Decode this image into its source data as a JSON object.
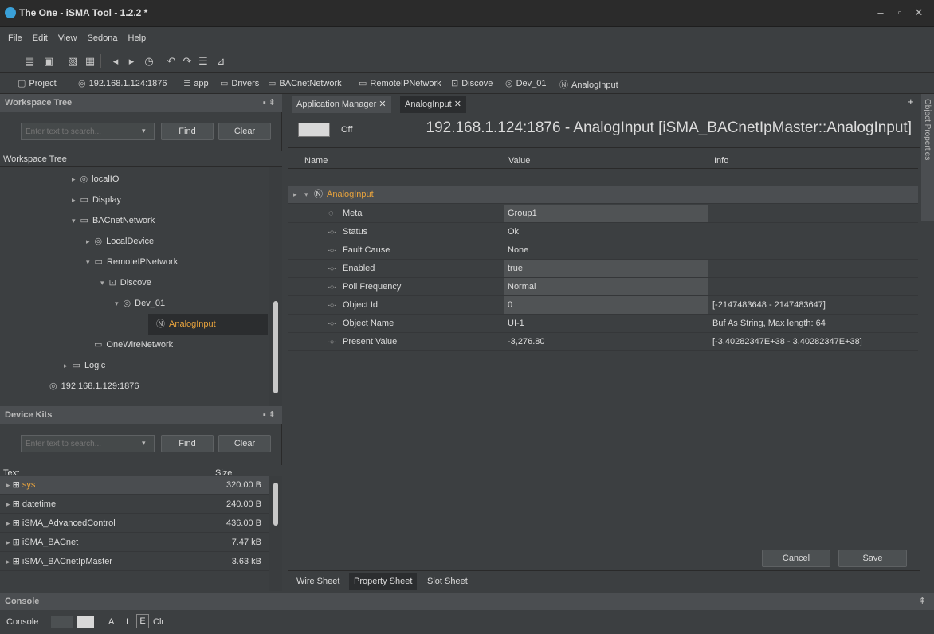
{
  "window": {
    "title": "The One - iSMA Tool - 1.2.2 *"
  },
  "menu": [
    "File",
    "Edit",
    "View",
    "Sedona",
    "Help"
  ],
  "breadcrumb": [
    {
      "icon": "document-icon",
      "label": "Project"
    },
    {
      "icon": "device-icon",
      "label": "192.168.1.124:1876"
    },
    {
      "icon": "database-icon",
      "label": "app"
    },
    {
      "icon": "folder-icon",
      "label": "Drivers"
    },
    {
      "icon": "folder-icon",
      "label": "BACnetNetwork"
    },
    {
      "icon": "folder-icon",
      "label": "RemoteIPNetwork"
    },
    {
      "icon": "discover-icon",
      "label": "Discove"
    },
    {
      "icon": "device-icon",
      "label": "Dev_01"
    },
    {
      "icon": "n-circle-icon",
      "label": "AnalogInput"
    }
  ],
  "workspace": {
    "header": "Workspace Tree",
    "search_placeholder": "Enter text to search...",
    "find": "Find",
    "clear": "Clear",
    "column": "Workspace Tree",
    "items": [
      {
        "label": "localIO",
        "icon": "device-icon",
        "arrow": "▸"
      },
      {
        "label": "Display",
        "icon": "display-icon",
        "arrow": "▸"
      },
      {
        "label": "BACnetNetwork",
        "icon": "folder-icon",
        "arrow": "▾"
      },
      {
        "label": "LocalDevice",
        "icon": "device-icon",
        "arrow": "▸"
      },
      {
        "label": "RemoteIPNetwork",
        "icon": "folder-icon",
        "arrow": "▾"
      },
      {
        "label": "Discove",
        "icon": "discover-icon",
        "arrow": "▾"
      },
      {
        "label": "Dev_01",
        "icon": "device-icon",
        "arrow": "▾"
      },
      {
        "label": "AnalogInput",
        "icon": "n-circle-icon",
        "arrow": ""
      },
      {
        "label": "OneWireNetwork",
        "icon": "folder-icon",
        "arrow": ""
      },
      {
        "label": "Logic",
        "icon": "folder-icon",
        "arrow": "▸"
      },
      {
        "label": "192.168.1.129:1876",
        "icon": "device-icon",
        "arrow": ""
      }
    ]
  },
  "kits": {
    "header": "Device Kits",
    "search_placeholder": "Enter text to search...",
    "find": "Find",
    "clear": "Clear",
    "col_text": "Text",
    "col_size": "Size",
    "rows": [
      {
        "name": "sys",
        "size": "320.00 B"
      },
      {
        "name": "datetime",
        "size": "240.00 B"
      },
      {
        "name": "iSMA_AdvancedControl",
        "size": "436.00 B"
      },
      {
        "name": "iSMA_BACnet",
        "size": "7.47 kB"
      },
      {
        "name": "iSMA_BACnetIpMaster",
        "size": "3.63 kB"
      }
    ]
  },
  "editor": {
    "tabs": [
      "Application Manager",
      "AnalogInput"
    ],
    "toggle_label": "Off",
    "heading": "192.168.1.124:1876 - AnalogInput [iSMA_BACnetIpMaster::AnalogInput]",
    "cols": [
      "Name",
      "Value",
      "Info"
    ],
    "root": "AnalogInput",
    "rows": [
      {
        "name": "Meta",
        "value": "Group1",
        "info": "",
        "editable": true
      },
      {
        "name": "Status",
        "value": "Ok",
        "info": "",
        "editable": false
      },
      {
        "name": "Fault Cause",
        "value": "None",
        "info": "",
        "editable": false
      },
      {
        "name": "Enabled",
        "value": "true",
        "info": "",
        "editable": true
      },
      {
        "name": "Poll Frequency",
        "value": "Normal",
        "info": "",
        "editable": true
      },
      {
        "name": "Object Id",
        "value": "0",
        "info": "[-2147483648 - 2147483647]",
        "editable": true
      },
      {
        "name": "Object Name",
        "value": "UI-1",
        "info": "Buf As String, Max length: 64",
        "editable": false
      },
      {
        "name": "Present Value",
        "value": "-3,276.80",
        "info": "[-3.40282347E+38 - 3.40282347E+38]",
        "editable": false
      }
    ],
    "cancel": "Cancel",
    "save": "Save",
    "bottom_tabs": [
      "Wire Sheet",
      "Property Sheet",
      "Slot Sheet"
    ],
    "side_label": "Object Properties"
  },
  "console": {
    "header": "Console",
    "label": "Console",
    "a": "A",
    "i": "I",
    "e": "E",
    "clr": "Clr"
  },
  "colors": {
    "accent": "#e8a33d",
    "bg": "#3c3f41",
    "field": "#505355"
  }
}
